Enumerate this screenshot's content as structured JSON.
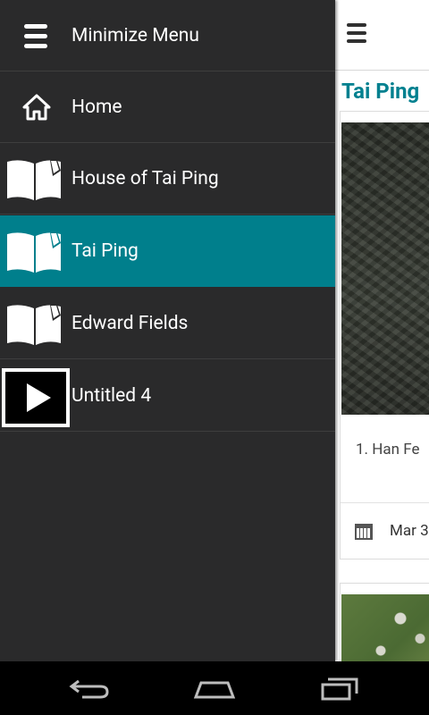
{
  "content": {
    "title": "Tai Ping",
    "card": {
      "item_text": "1. Han Fe",
      "date": "Mar 3"
    }
  },
  "drawer": {
    "items": [
      {
        "label": "Minimize Menu",
        "icon": "hamburger-icon",
        "active": false
      },
      {
        "label": "Home",
        "icon": "home-icon",
        "active": false
      },
      {
        "label": "House of Tai Ping",
        "icon": "book-icon",
        "active": false
      },
      {
        "label": "Tai Ping",
        "icon": "book-icon",
        "active": true
      },
      {
        "label": "Edward Fields",
        "icon": "book-icon",
        "active": false
      },
      {
        "label": "Untitled 4",
        "icon": "play-icon",
        "active": false
      }
    ]
  },
  "navbar": {
    "buttons": [
      "back-icon",
      "home-icon",
      "recent-apps-icon"
    ]
  },
  "colors": {
    "drawer_bg": "#2a2a2b",
    "active_bg": "#007f8c",
    "title_color": "#00808f"
  }
}
